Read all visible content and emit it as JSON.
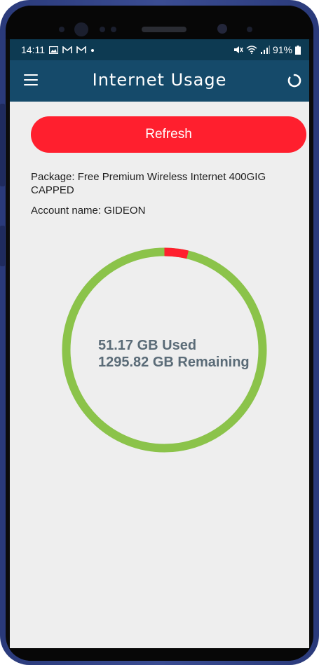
{
  "status_bar": {
    "time": "14:11",
    "notification_icons": [
      "image-icon",
      "gmail-icon",
      "gmail-icon",
      "dot-icon"
    ],
    "battery": "91%"
  },
  "app_bar": {
    "title": "Internet Usage"
  },
  "refresh_label": "Refresh",
  "package_line": "Package: Free Premium Wireless Internet 400GIG CAPPED",
  "account_line": "Account name: GIDEON",
  "usage": {
    "used_text": "51.17 GB Used",
    "remaining_text": "1295.82 GB Remaining",
    "used_fraction": 0.038
  },
  "colors": {
    "status_bar_bg": "#0d3a52",
    "app_bar_bg": "#154a6a",
    "accent_red": "#ff1f2e",
    "gauge_remaining": "#8bc34a",
    "gauge_used": "#ff1f2e",
    "screen_bg": "#eeeeee"
  }
}
